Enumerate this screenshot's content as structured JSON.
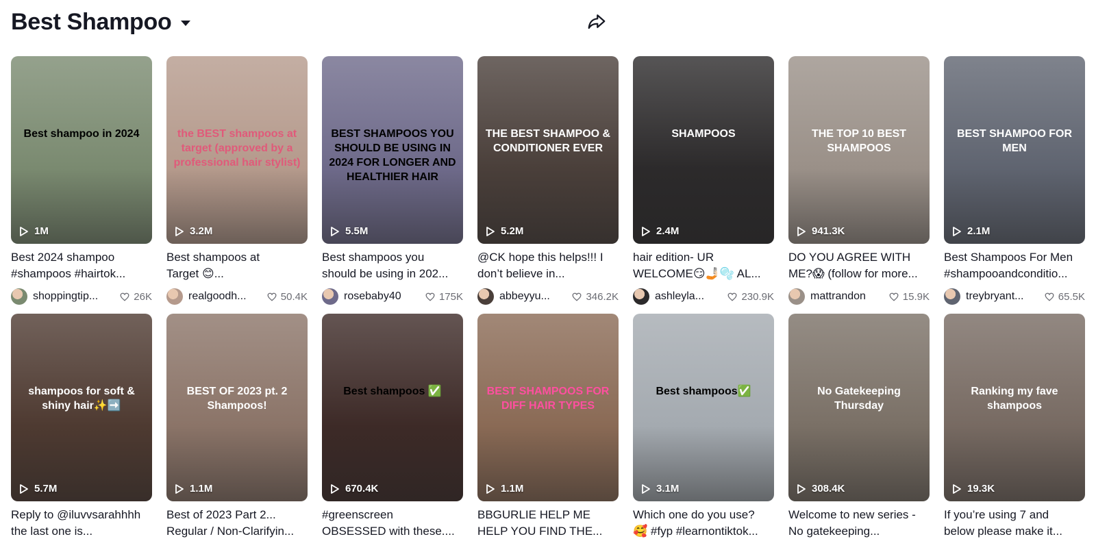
{
  "header": {
    "title": "Best Shampoo"
  },
  "videos": [
    {
      "views": "1M",
      "line1": "Best 2024 shampoo",
      "line2": "#shampoos #hairtok...",
      "user": "shoppingtip...",
      "likes": "26K",
      "overlay": "Best shampoo in 2024",
      "bg": "#7a8a70",
      "fg": "#000000"
    },
    {
      "views": "3.2M",
      "line1": "Best shampoos at",
      "line2": "Target 😊...",
      "user": "realgoodh...",
      "likes": "50.4K",
      "overlay": "the BEST shampoos at target (approved by a professional hair stylist)",
      "bg": "#b59a8c",
      "fg": "#e05a7a"
    },
    {
      "views": "5.5M",
      "line1": "Best shampoos you",
      "line2": "should be using in 202...",
      "user": "rosebaby40",
      "likes": "175K",
      "overlay": "BEST SHAMPOOS YOU SHOULD BE USING IN 2024 FOR LONGER AND HEALTHIER HAIR",
      "bg": "#6e6a8a",
      "fg": "#000000"
    },
    {
      "views": "5.2M",
      "line1": "@CK hope this helps!!! I",
      "line2": "don’t believe in...",
      "user": "abbeyyu...",
      "likes": "346.2K",
      "overlay": "THE BEST SHAMPOO & CONDITIONER EVER",
      "bg": "#4a3f3a",
      "fg": "#ffffff"
    },
    {
      "views": "2.4M",
      "line1": "hair edition- UR",
      "line2": "WELCOME😏🤳🏻🫧 AL...",
      "user": "ashleyla...",
      "likes": "230.9K",
      "overlay": "SHAMPOOS",
      "bg": "#2c2a2b",
      "fg": "#ffffff"
    },
    {
      "views": "941.3K",
      "line1": "DO YOU AGREE WITH",
      "line2": "ME?😱 (follow for more...",
      "user": "mattrandon",
      "likes": "15.9K",
      "overlay": "THE TOP 10 BEST SHAMPOOS",
      "bg": "#9a9088",
      "fg": "#ffffff"
    },
    {
      "views": "2.1M",
      "line1": "Best Shampoos For Men",
      "line2": "#shampooandconditio...",
      "user": "treybryant...",
      "likes": "65.5K",
      "overlay": "BEST SHAMPOO FOR MEN",
      "bg": "#5f6470",
      "fg": "#ffffff"
    },
    {
      "views": "5.7M",
      "line1": "Reply to @iluvvsarahhhh",
      "line2": "the last one is...",
      "user": "",
      "likes": "",
      "overlay": "shampoos for soft & shiny hair✨➡️",
      "bg": "#4e3a31",
      "fg": "#ffffff"
    },
    {
      "views": "1.1M",
      "line1": "Best of 2023 Part 2...",
      "line2": "Regular / Non-Clarifyin...",
      "user": "",
      "likes": "",
      "overlay": "BEST OF 2023 pt. 2 Shampoos!",
      "bg": "#8b7468",
      "fg": "#ffffff"
    },
    {
      "views": "670.4K",
      "line1": "#greenscreen",
      "line2": "OBSESSED with these....",
      "user": "",
      "likes": "",
      "overlay": "Best shampoos ✅",
      "bg": "#3d2a27",
      "fg": "#000000"
    },
    {
      "views": "1.1M",
      "line1": "BBGURLIE HELP ME",
      "line2": "HELP YOU FIND THE...",
      "user": "",
      "likes": "",
      "overlay": "BEST SHAMPOOS FOR DIFF HAIR TYPES",
      "bg": "#8a6a55",
      "fg": "#ff4fa0"
    },
    {
      "views": "3.1M",
      "line1": "Which one do you use?",
      "line2": "🥰 #fyp #learnontiktok...",
      "user": "",
      "likes": "",
      "overlay": "Best shampoos✅",
      "bg": "#a4aab0",
      "fg": "#000000"
    },
    {
      "views": "308.4K",
      "line1": "Welcome to new series -",
      "line2": "No gatekeeping...",
      "user": "",
      "likes": "",
      "overlay": "No Gatekeeping Thursday",
      "bg": "#7a7066",
      "fg": "#ffffff"
    },
    {
      "views": "19.3K",
      "line1": "If you’re using 7 and",
      "line2": "below please make it...",
      "user": "",
      "likes": "",
      "overlay": "Ranking my fave shampoos",
      "bg": "#776a62",
      "fg": "#ffffff"
    }
  ]
}
